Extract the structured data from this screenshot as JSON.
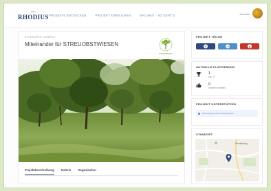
{
  "header": {
    "logo_small": "PRO",
    "logo_main": "RHODIUS",
    "nav": [
      "PROJEKTE ENTDECKEN",
      "PROJEKT EINREICHEN",
      "MACHMIT · SO GEHT'S"
    ],
    "user_name": "Anmelden"
  },
  "project": {
    "category": "KATEGORIE: UMWELT",
    "title": "Miteinander für STREUOBSTWIESEN",
    "tabs": [
      "Projektbeschreibung",
      "Galerie",
      "Organisation"
    ],
    "active_tab": "Projektbeschreibung",
    "emblem_caption": "Streuobstwiesen"
  },
  "sidebar": {
    "share": {
      "heading": "PROJEKT TEILEN",
      "buttons": [
        {
          "network": "facebook",
          "color": "#2c4a7e"
        },
        {
          "network": "twitter",
          "color": "#4f8ec9"
        },
        {
          "network": "pinterest",
          "color": "#c0392b"
        }
      ]
    },
    "placement": {
      "heading": "AKTUELLE PLATZIERUNG",
      "rank": "1",
      "rank_label": "von 17",
      "votes": "0",
      "votes_label": "Stimmen erhalten"
    },
    "support": {
      "heading": "PROJEKT UNTERSTÜTZEN",
      "notice": "Das Voting ist noch nicht gestartet"
    },
    "location": {
      "heading": "STANDORT",
      "map_label": "Rhodiusweg"
    }
  }
}
